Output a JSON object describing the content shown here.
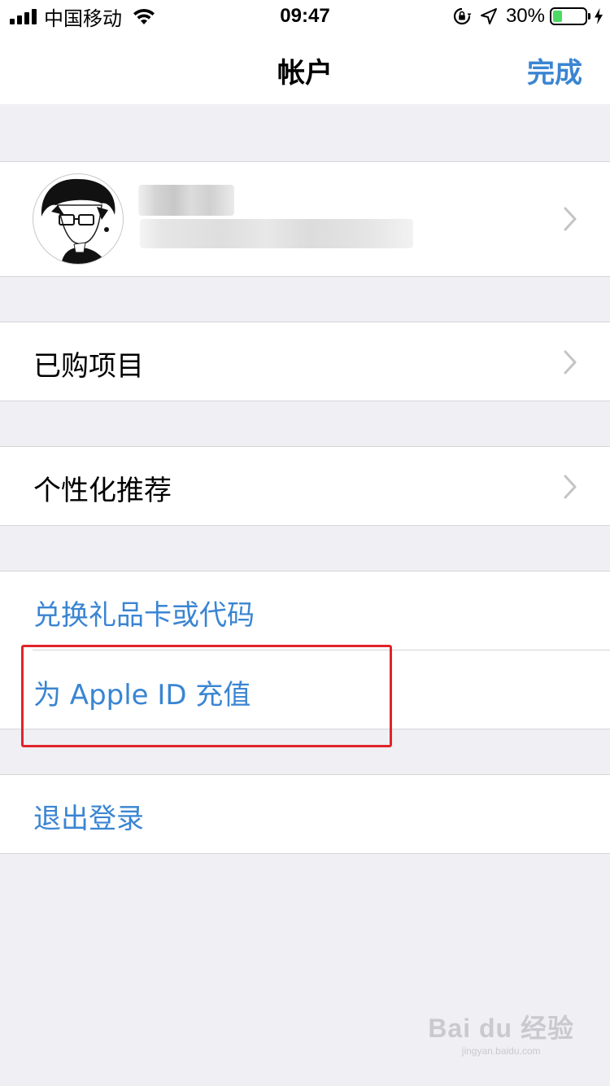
{
  "status_bar": {
    "carrier": "中国移动",
    "time": "09:47",
    "battery_percent": "30%",
    "battery_level": 0.3,
    "battery_color": "#4cd964"
  },
  "nav": {
    "title": "帐户",
    "done_label": "完成",
    "accent_color": "#3a85d2"
  },
  "account": {
    "avatar": "user-avatar-image",
    "name_redacted": true,
    "email_redacted": true
  },
  "menu": {
    "purchased": "已购项目",
    "personalized": "个性化推荐",
    "redeem": "兑换礼品卡或代码",
    "add_funds": "为 Apple ID 充值",
    "sign_out": "退出登录"
  },
  "annotation": {
    "highlight_color": "#e0242a"
  },
  "watermark": {
    "line1": "Bai du 经验",
    "line2": "jingyan.baidu.com"
  }
}
